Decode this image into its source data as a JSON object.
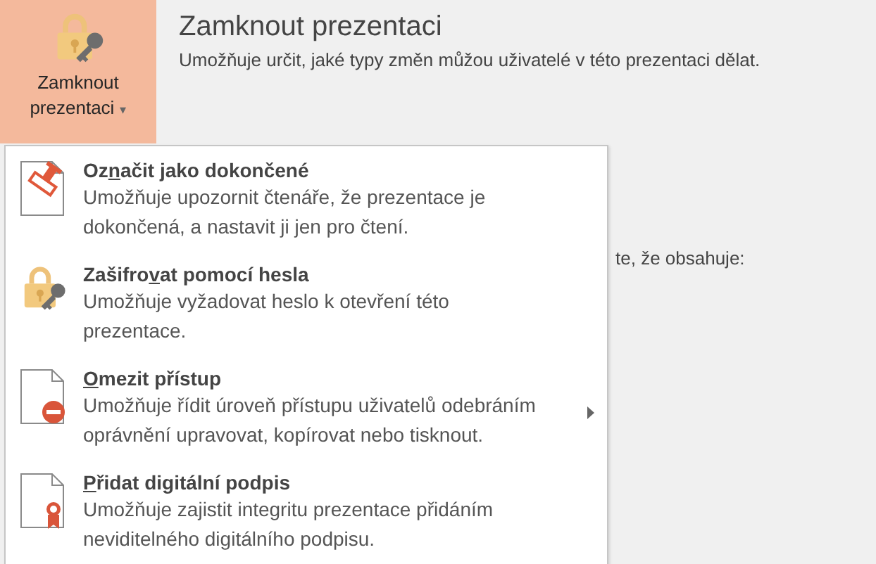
{
  "lock_button": {
    "line_1": "Zamknout",
    "line_2": "prezentaci",
    "caret": "▾"
  },
  "section": {
    "title": "Zamknout prezentaci",
    "description": "Umožňuje určit, jaké typy změn můžou uživatelé v této prezentaci dělat."
  },
  "background_text": "te, že obsahuje:",
  "menu": {
    "items": [
      {
        "kind": "stamp",
        "title": [
          {
            "text": "Oz",
            "underlined": false
          },
          {
            "text": "n",
            "underlined": true
          },
          {
            "text": "ačit jako dokončené",
            "underlined": false
          }
        ],
        "description": "Umožňuje upozornit čtenáře, že prezentace je dokončená, a nastavit ji jen pro čtení.",
        "submenu": false
      },
      {
        "kind": "lock",
        "title": [
          {
            "text": "Zašifro",
            "underlined": false
          },
          {
            "text": "v",
            "underlined": true
          },
          {
            "text": "at pomocí hesla",
            "underlined": false
          }
        ],
        "description": "Umožňuje vyžadovat heslo k otevření této prezentace.",
        "submenu": false
      },
      {
        "kind": "restrict",
        "title": [
          {
            "text": "O",
            "underlined": true
          },
          {
            "text": "mezit přístup",
            "underlined": false
          }
        ],
        "description": "Umožňuje řídit úroveň přístupu uživatelů odebráním oprávnění upravovat, kopírovat nebo tisknout.",
        "submenu": true
      },
      {
        "kind": "signature",
        "title": [
          {
            "text": "P",
            "underlined": true
          },
          {
            "text": "řidat digitální podpis",
            "underlined": false
          }
        ],
        "description": "Umožňuje zajistit integritu prezentace přidáním neviditelného digitálního podpisu.",
        "submenu": false
      }
    ]
  }
}
